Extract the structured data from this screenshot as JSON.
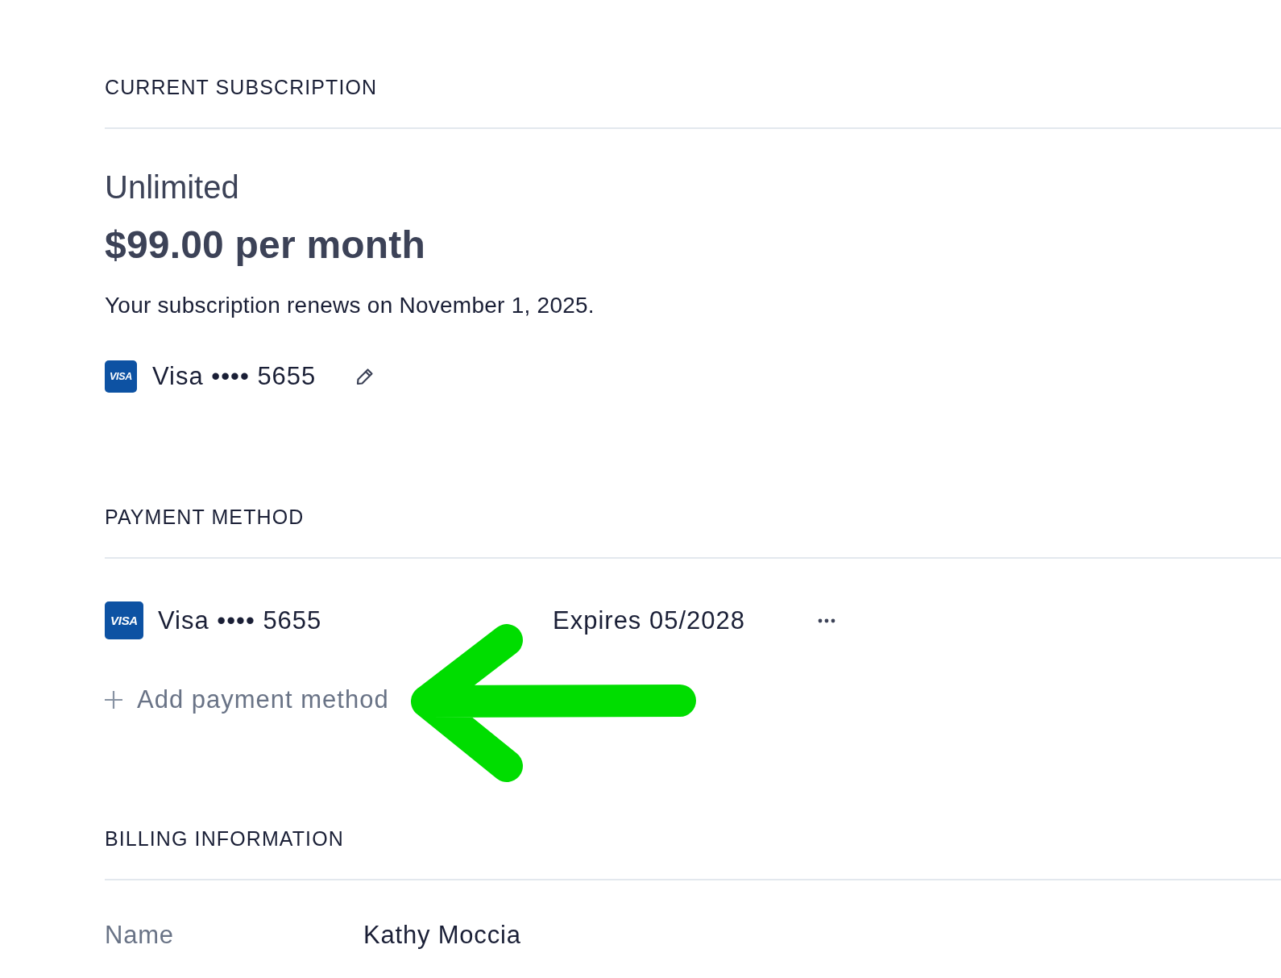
{
  "current_subscription": {
    "heading": "CURRENT SUBSCRIPTION",
    "plan": "Unlimited",
    "price": "$99.00 per month",
    "renewal_note": "Your subscription renews on November 1, 2025.",
    "card": {
      "brand_mark": "VISA",
      "label": "Visa •••• 5655"
    }
  },
  "payment_method": {
    "heading": "PAYMENT METHOD",
    "cards": [
      {
        "brand_mark": "VISA",
        "label": "Visa •••• 5655",
        "expiry": "Expires 05/2028"
      }
    ],
    "add_action": {
      "label": "Add payment method"
    },
    "pointer_arrow": true
  },
  "billing_information": {
    "heading": "BILLING INFORMATION",
    "fields": [
      {
        "label": "Name",
        "value": "Kathy Moccia"
      }
    ]
  }
}
